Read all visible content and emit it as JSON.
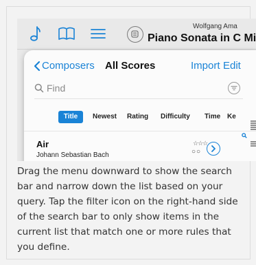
{
  "toolbar": {
    "icons": [
      "music-note-icon",
      "book-icon",
      "list-icon",
      "score-icon"
    ],
    "composer_truncated": "Wolfgang Ama",
    "score_title": "Piano Sonata in C Minor,"
  },
  "nav": {
    "back_label": "Composers",
    "title": "All Scores",
    "import_label": "Import",
    "edit_label": "Edit"
  },
  "search": {
    "placeholder": "Find",
    "value": ""
  },
  "tabs": [
    {
      "label": "Title",
      "active": true
    },
    {
      "label": "Newest",
      "active": false
    },
    {
      "label": "Rating",
      "active": false
    },
    {
      "label": "Difficulty",
      "active": false
    },
    {
      "label": "Time",
      "active": false
    },
    {
      "label": "Ke",
      "active": false
    }
  ],
  "list": [
    {
      "title": "Air",
      "composer": "Johann Sebastian Bach",
      "rating_stars": "☆☆☆",
      "difficulty_dots": "○○"
    }
  ],
  "caption": "Drag the menu downward to show the search bar and narrow down the list based on your query. Tap the filter icon on the right-hand side of the search bar to only show items in the current list that match one or more rules that you define.",
  "colors": {
    "accent": "#1a83d6",
    "background": "#f3f3f3"
  }
}
